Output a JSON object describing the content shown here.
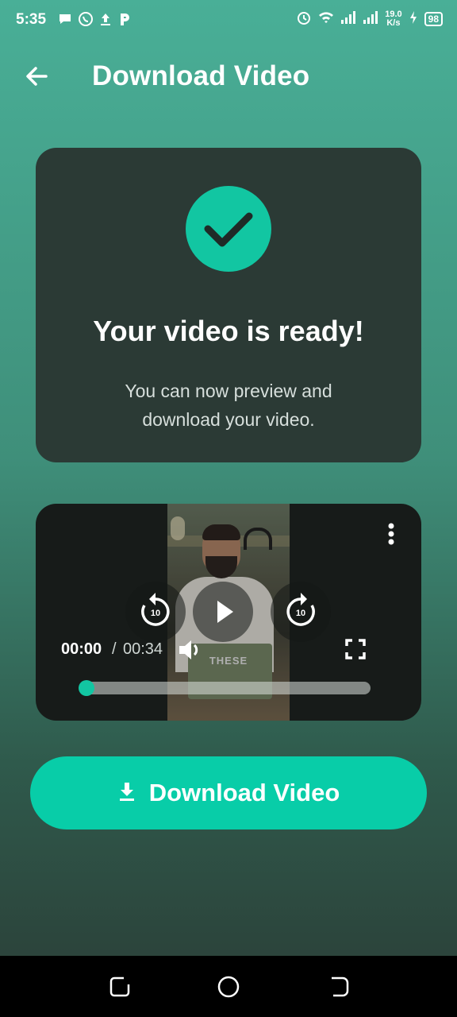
{
  "status_bar": {
    "time": "5:35",
    "notification_icons": [
      "chat-bubble-icon",
      "whatsapp-icon",
      "upload-icon",
      "p-icon"
    ],
    "network_speed": "19.0",
    "network_speed_unit": "K/s",
    "battery": "98"
  },
  "app_bar": {
    "title": "Download Video",
    "back_icon": "arrow-left-icon"
  },
  "ready_card": {
    "heading": "Your video is ready!",
    "subtext": "You can now preview and download your video.",
    "accent_color": "#12c6a2"
  },
  "video_player": {
    "current_time": "00:00",
    "separator": "/",
    "total_time": "00:34",
    "overlay_text": "THESE",
    "rewind_label": "10",
    "forward_label": "10",
    "progress": 0.0
  },
  "download_button": {
    "label": "Download Video",
    "color": "#08cda8"
  },
  "nav_bar": {
    "buttons": [
      "recents-icon",
      "home-icon",
      "back-icon"
    ]
  }
}
